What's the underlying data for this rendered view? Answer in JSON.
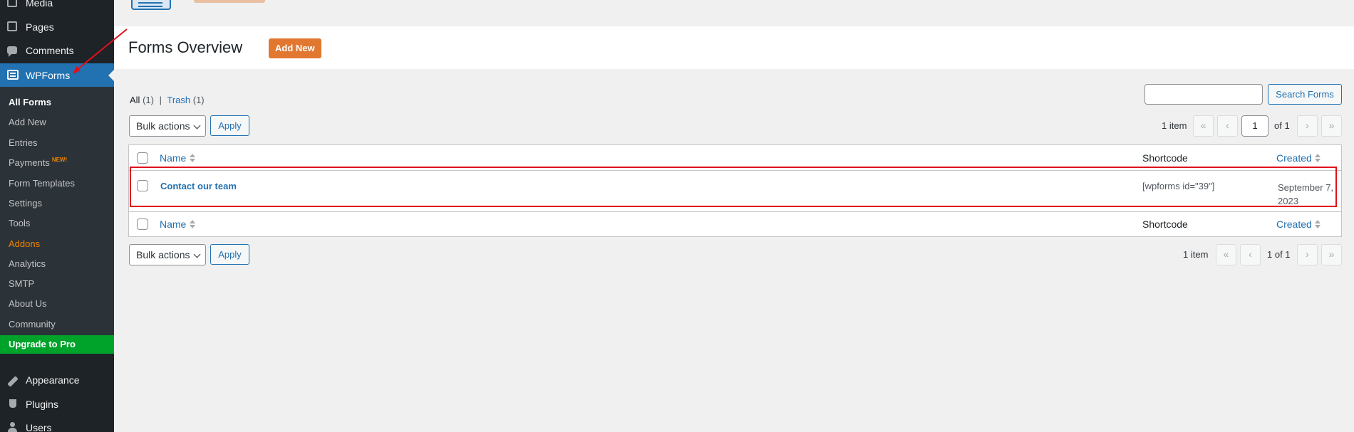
{
  "sidebar": {
    "top_items": [
      {
        "label": "Media",
        "icon": "media-icon"
      },
      {
        "label": "Pages",
        "icon": "pages-icon"
      },
      {
        "label": "Comments",
        "icon": "comments-icon"
      },
      {
        "label": "WPForms",
        "icon": "wpforms-icon"
      }
    ],
    "sub_items": [
      {
        "label": "All Forms"
      },
      {
        "label": "Add New"
      },
      {
        "label": "Entries"
      },
      {
        "label": "Payments",
        "badge": "NEW!"
      },
      {
        "label": "Form Templates"
      },
      {
        "label": "Settings"
      },
      {
        "label": "Tools"
      },
      {
        "label": "Addons"
      },
      {
        "label": "Analytics"
      },
      {
        "label": "SMTP"
      },
      {
        "label": "About Us"
      },
      {
        "label": "Community"
      }
    ],
    "upgrade_label": "Upgrade to Pro",
    "bottom_items": [
      {
        "label": "Appearance",
        "icon": "appearance-icon"
      },
      {
        "label": "Plugins",
        "icon": "plugins-icon"
      },
      {
        "label": "Users",
        "icon": "users-icon"
      }
    ]
  },
  "header": {
    "title": "Forms Overview",
    "add_new_label": "Add New"
  },
  "views": {
    "all_label": "All",
    "all_count": "(1)",
    "separator": "|",
    "trash_label": "Trash",
    "trash_count": "(1)"
  },
  "search": {
    "button_label": "Search Forms",
    "value": ""
  },
  "top_nav": {
    "bulk_label": "Bulk actions",
    "apply_label": "Apply",
    "item_count": "1 item",
    "first": "«",
    "prev": "‹",
    "current_page": "1",
    "of_total": "of 1",
    "next": "›",
    "last": "»"
  },
  "bottom_nav": {
    "bulk_label": "Bulk actions",
    "apply_label": "Apply",
    "item_count": "1 item",
    "first": "«",
    "prev": "‹",
    "page_text": "1 of 1",
    "next": "›",
    "last": "»"
  },
  "table": {
    "columns": {
      "name": "Name",
      "shortcode": "Shortcode",
      "created": "Created"
    },
    "rows": [
      {
        "name": "Contact our team",
        "shortcode": "[wpforms id=\"39\"]",
        "created": "September 7, 2023"
      }
    ]
  },
  "colors": {
    "sidebar_bg": "#1d2327",
    "active_menu": "#2271b1",
    "accent_orange": "#e27730",
    "upgrade_green": "#00a32a",
    "highlight_red": "#e0101b"
  }
}
